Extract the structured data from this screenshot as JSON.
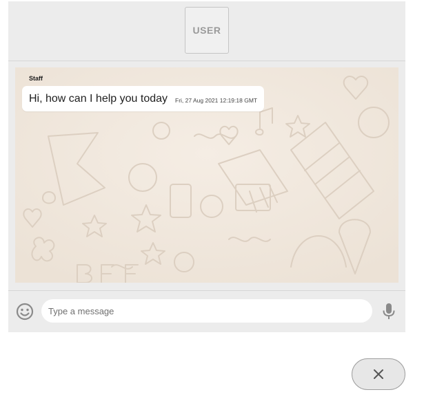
{
  "header": {
    "avatar_label": "USER"
  },
  "conversation": {
    "messages": [
      {
        "sender": "Staff",
        "text": "Hi, how can I help you today",
        "timestamp": "Fri, 27 Aug 2021 12:19:18 GMT"
      }
    ]
  },
  "composer": {
    "placeholder": "Type a message",
    "emoji_icon": "smiley-face-icon",
    "mic_icon": "microphone-icon"
  },
  "close_button": {
    "icon": "close-x-icon"
  },
  "colors": {
    "window_bg": "#ececec",
    "chat_wallpaper": "#efe5da",
    "bubble_bg": "#ffffff",
    "icon_gray": "#8a8a8a"
  }
}
